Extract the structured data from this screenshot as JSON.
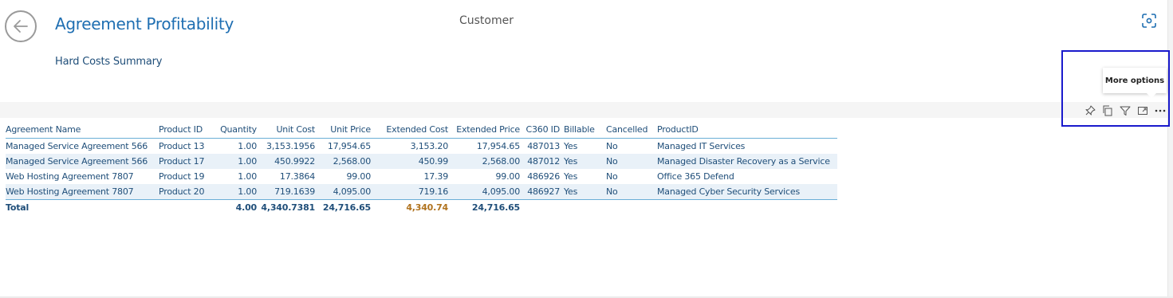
{
  "header": {
    "title": "Agreement Profitability",
    "subtitle": "Hard Costs Summary",
    "center_label": "Customer"
  },
  "icons": {
    "back": "back-arrow-icon",
    "focus": "focus-mode-icon",
    "pin": "pin-icon",
    "copy": "copy-icon",
    "filter": "filter-icon",
    "expand": "expand-icon",
    "more": "more-options-icon"
  },
  "tooltip": {
    "text": "More options"
  },
  "colors": {
    "accent": "#1f6fb2",
    "text": "#1f4e79",
    "row_alt": "#e9f1f8",
    "total_highlight": "#b0731f",
    "focus_box": "#1a1acc"
  },
  "table": {
    "columns": [
      "Agreement Name",
      "Product ID",
      "Quantity",
      "Unit Cost",
      "Unit Price",
      "Extended Cost",
      "Extended Price",
      "C360 ID",
      "Billable",
      "Cancelled",
      "ProductID"
    ],
    "rows": [
      [
        "Managed Service Agreement 566",
        "Product 13",
        "1.00",
        "3,153.1956",
        "17,954.65",
        "3,153.20",
        "17,954.65",
        "487013",
        "Yes",
        "No",
        "Managed IT Services"
      ],
      [
        "Managed Service Agreement 566",
        "Product 17",
        "1.00",
        "450.9922",
        "2,568.00",
        "450.99",
        "2,568.00",
        "487012",
        "Yes",
        "No",
        "Managed Disaster Recovery as a Service"
      ],
      [
        "Web Hosting Agreement 7807",
        "Product 19",
        "1.00",
        "17.3864",
        "99.00",
        "17.39",
        "99.00",
        "486926",
        "Yes",
        "No",
        "Office 365 Defend"
      ],
      [
        "Web Hosting Agreement 7807",
        "Product 20",
        "1.00",
        "719.1639",
        "4,095.00",
        "719.16",
        "4,095.00",
        "486927",
        "Yes",
        "No",
        "Managed Cyber Security Services"
      ]
    ],
    "total": [
      "Total",
      "",
      "4.00",
      "4,340.7381",
      "24,716.65",
      "4,340.74",
      "24,716.65",
      "",
      "",
      "",
      ""
    ]
  }
}
